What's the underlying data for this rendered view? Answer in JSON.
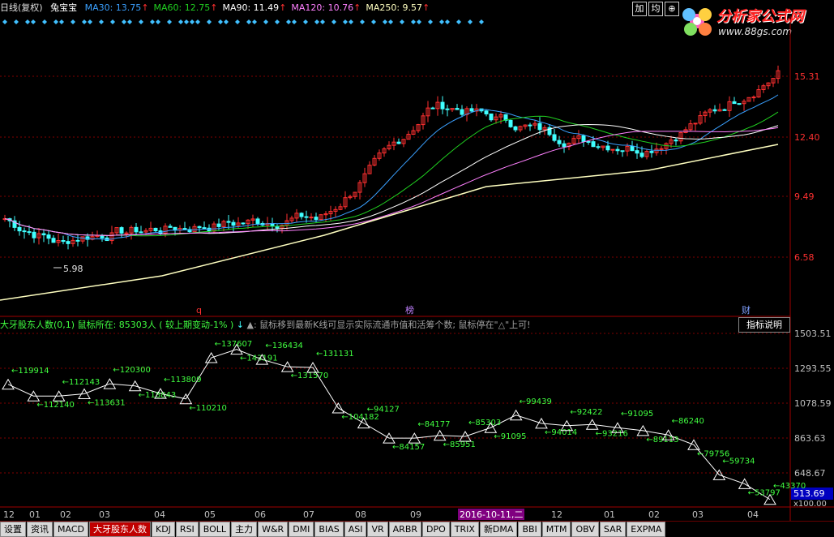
{
  "header": {
    "period": "日线(复权)",
    "stock": "兔宝宝",
    "ma": [
      {
        "label": "MA30: 13.75",
        "color": "#3aa0ff"
      },
      {
        "label": "MA60: 12.75",
        "color": "#20d020"
      },
      {
        "label": "MA90: 11.49",
        "color": "#ffffff"
      },
      {
        "label": "MA120: 10.76",
        "color": "#ff80ff"
      },
      {
        "label": "MA250: 9.57",
        "color": "#ffffc0"
      }
    ],
    "buttons": [
      "加",
      "均",
      "⊕"
    ]
  },
  "logo": {
    "title": "分析家公式网",
    "url": "www.88gs.com"
  },
  "price_axis": [
    "15.31",
    "12.40",
    "9.49",
    "6.58"
  ],
  "price_low_label": "5.98",
  "markers": [
    {
      "text": "q",
      "color": "#ff3030"
    },
    {
      "text": "榜",
      "color": "#c080ff"
    },
    {
      "text": "财",
      "color": "#80a0ff"
    }
  ],
  "indicator": {
    "title": "大牙股东人数(0,1)",
    "mouse": "鼠标所在: 85303人 ( 较上期变动-1% )",
    "down_arrow": "↓",
    "tip": "▲: 鼠标移到最新K线可显示实际流通市值和活筹个数; 鼠标停在\"△\"上可!",
    "button": "指标说明",
    "axis": [
      "1503.51",
      "1293.55",
      "1078.59",
      "863.63",
      "648.67"
    ],
    "current": "513.69",
    "current_suffix": "x100.00",
    "labels": [
      "119914",
      "112140",
      "112143",
      "113631",
      "120300",
      "118843",
      "113809",
      "110210",
      "137607",
      "143191",
      "136434",
      "131570",
      "131131",
      "104182",
      "94127",
      "84157",
      "84177",
      "85951",
      "85303",
      "91095",
      "99439",
      "94014",
      "92422",
      "93216",
      "91095",
      "89113",
      "86240",
      "79756",
      "59734",
      "53797",
      "43370"
    ]
  },
  "time_axis": [
    "12",
    "01",
    "02",
    "03",
    "04",
    "05",
    "06",
    "07",
    "08",
    "09",
    "2016-10-11,二",
    "12",
    "01",
    "02",
    "03",
    "04"
  ],
  "tabs": [
    "设置",
    "资讯",
    "MACD",
    "大牙股东人数",
    "KDJ",
    "RSI",
    "BOLL",
    "主力",
    "W&R",
    "DMI",
    "BIAS",
    "ASI",
    "VR",
    "ARBR",
    "DPO",
    "TRIX",
    "新DMA",
    "BBI",
    "MTM",
    "OBV",
    "SAR",
    "EXPMA"
  ],
  "active_tab": "大牙股东人数",
  "colors": {
    "up": "#ff3030",
    "down": "#40ffff",
    "grid": "#800000",
    "label": "#40ff40"
  },
  "chart_data": {
    "type": "table",
    "holders": [
      119914,
      112140,
      112143,
      113631,
      120300,
      118843,
      113809,
      110210,
      137607,
      143191,
      136434,
      131570,
      131131,
      104182,
      94127,
      84157,
      84177,
      85951,
      85303,
      91095,
      99439,
      94014,
      92422,
      93216,
      91095,
      89113,
      86240,
      79756,
      59734,
      53797,
      43370
    ]
  }
}
